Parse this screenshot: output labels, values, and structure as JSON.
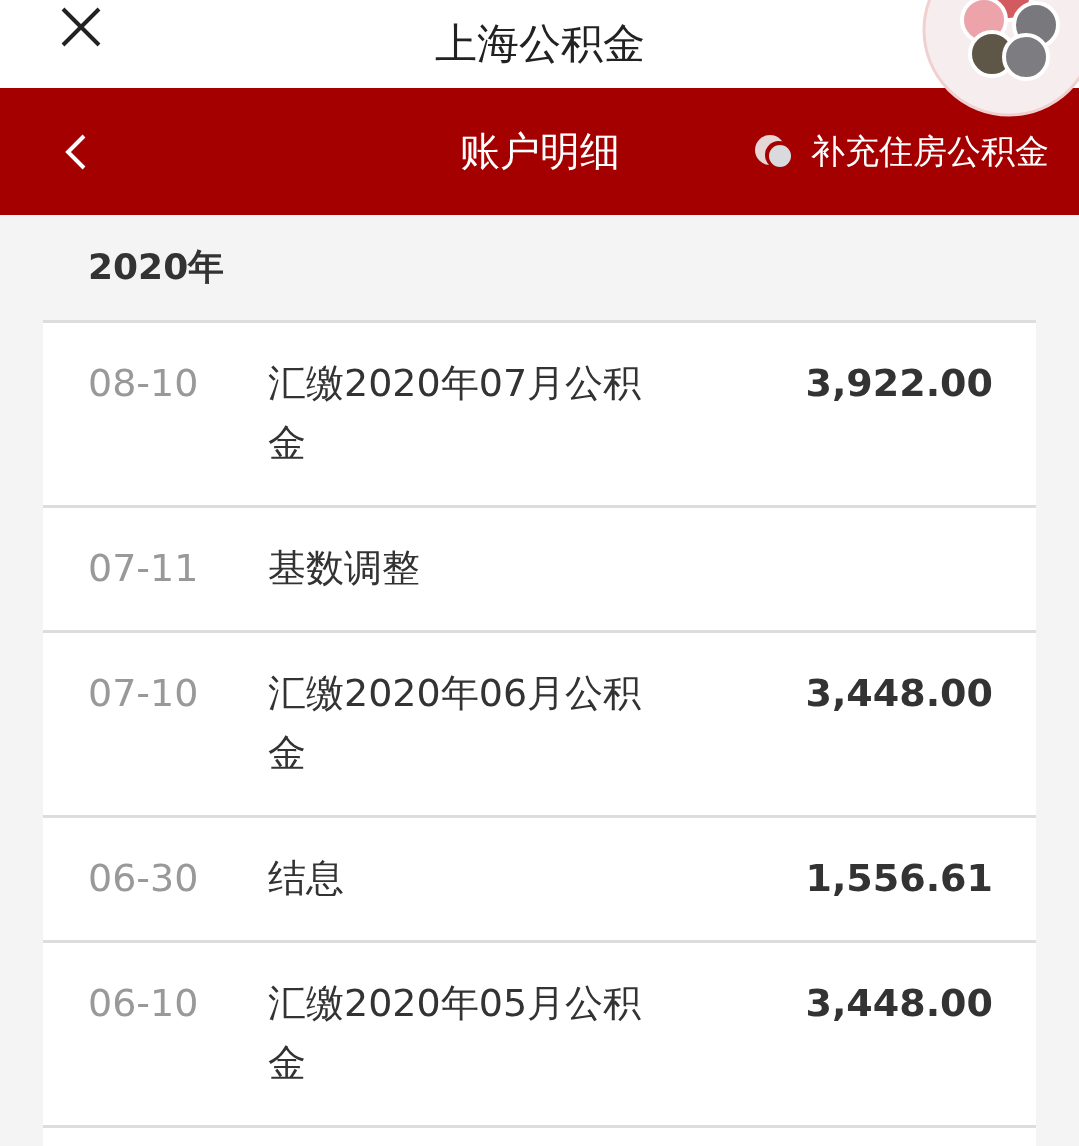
{
  "top_bar": {
    "title": "上海公积金"
  },
  "nav_bar": {
    "title": "账户明细",
    "switch_label": "补充住房公积金"
  },
  "year": "2020年",
  "records": [
    {
      "date": "08-10",
      "description": "汇缴2020年07月公积金",
      "amount": "3,922.00"
    },
    {
      "date": "07-11",
      "description": "基数调整"
    },
    {
      "date": "07-10",
      "description": "汇缴2020年06月公积金",
      "amount": "3,448.00"
    },
    {
      "date": "06-30",
      "description": "结息",
      "amount": "1,556.61"
    },
    {
      "date": "06-10",
      "description": "汇缴2020年05月公积金",
      "amount": "3,448.00"
    }
  ]
}
